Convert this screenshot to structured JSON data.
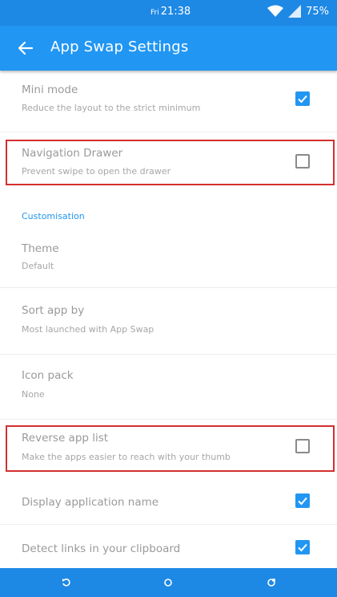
{
  "status_bar": {
    "day": "Fri",
    "time": "21:38",
    "battery": "75%"
  },
  "app_bar": {
    "title": "App Swap Settings"
  },
  "settings": {
    "mini_mode": {
      "title": "Mini mode",
      "subtitle": "Reduce the layout to the strict minimum",
      "checked": true
    },
    "navigation_drawer": {
      "title": "Navigation Drawer",
      "subtitle": "Prevent swipe to open the drawer",
      "checked": false
    },
    "section_customisation": "Customisation",
    "theme": {
      "title": "Theme",
      "value": "Default"
    },
    "sort_app_by": {
      "title": "Sort app by",
      "value": "Most launched with App Swap"
    },
    "icon_pack": {
      "title": "Icon pack",
      "value": "None"
    },
    "reverse_app_list": {
      "title": "Reverse app list",
      "subtitle": "Make the apps easier to reach with your thumb",
      "checked": false
    },
    "display_application_name": {
      "title": "Display application name",
      "checked": true
    },
    "detect_links": {
      "title": "Detect links in your clipboard",
      "checked": true
    }
  },
  "colors": {
    "primary": "#2196f3",
    "status_bar": "#1e88e5",
    "highlight": "#d32f2f"
  },
  "icons": {
    "back": "arrow-left-icon",
    "wifi": "wifi-icon",
    "signal": "signal-icon",
    "nav_back": "rotate-back-icon",
    "nav_home": "circle-home-icon",
    "nav_recent": "recent-apps-icon"
  }
}
